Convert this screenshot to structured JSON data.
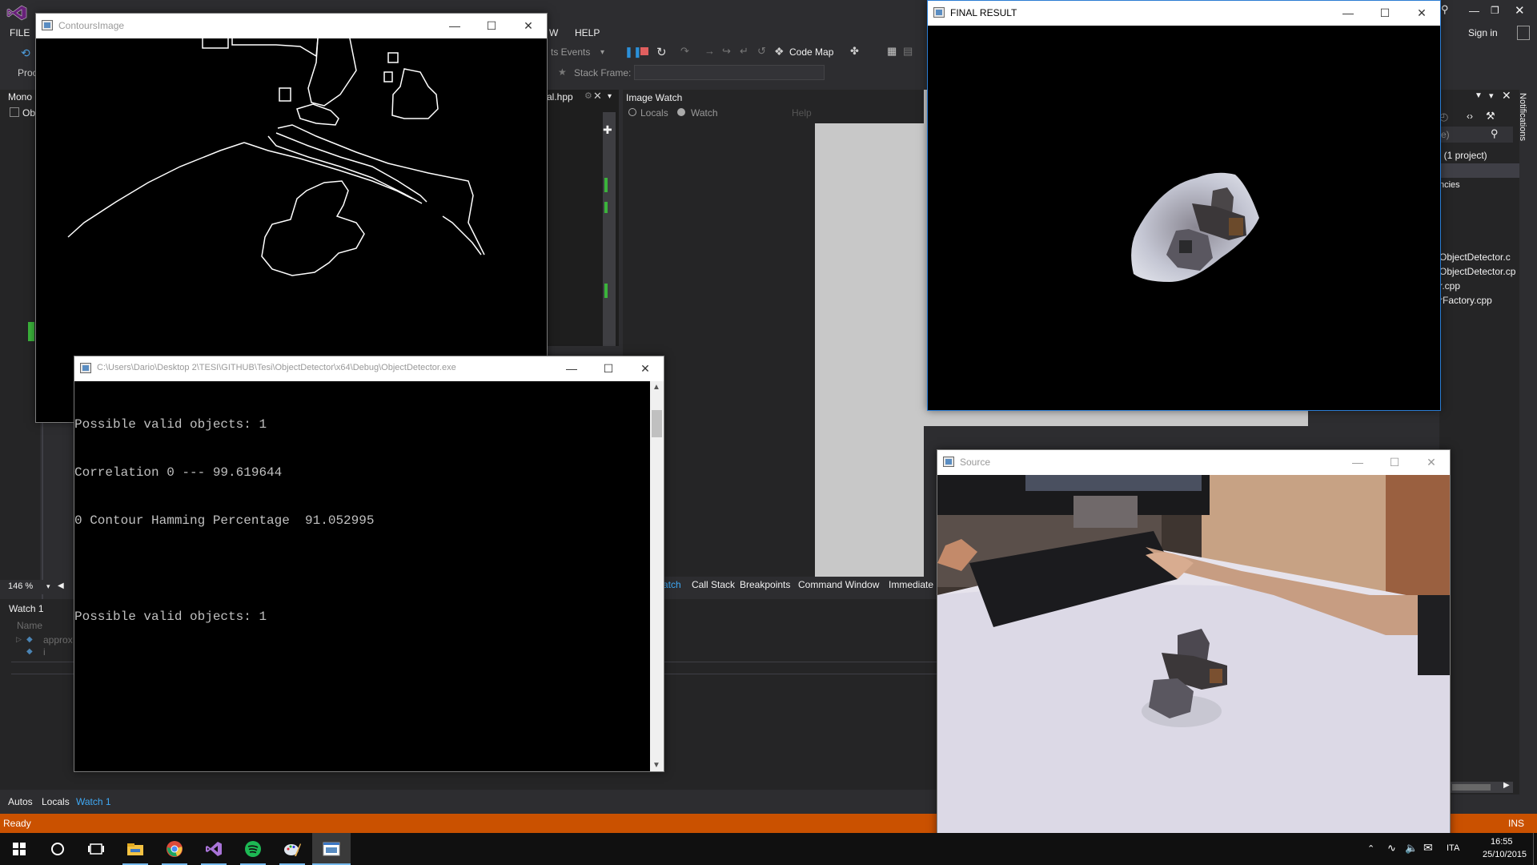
{
  "vs": {
    "menu": {
      "file": "FILE",
      "view_tail": "W",
      "help": "HELP"
    },
    "user": {
      "sign_in": "Sign in"
    },
    "toolbar": {
      "lifecycle": "ts Events",
      "code_map": "Code Map",
      "stack_frame": "Stack Frame:"
    },
    "left_panel": {
      "tab": "Mono",
      "item": "Ob",
      "prefix": "Proc"
    },
    "editor": {
      "file_tab": "al.hpp"
    },
    "image_watch": {
      "title": "Image Watch",
      "radio_locals": "Locals",
      "radio_watch": "Watch",
      "help": "Help"
    },
    "zoom": "146 %",
    "watch": {
      "title": "Watch 1",
      "column_name": "Name",
      "row1": "approx",
      "row2": "i"
    },
    "debug_tabs": [
      "atch",
      "Call Stack",
      "Breakpoints",
      "Command Window",
      "Immediate"
    ],
    "bottom_tabs": [
      "Autos",
      "Locals",
      "Watch 1"
    ],
    "solution": {
      "project": "' (1 project)",
      "deps": "ncies",
      "files": [
        "ObjectDetector.c",
        "ObjectDetector.cp",
        "r.cpp",
        "rFactory.cpp"
      ]
    },
    "notifications": "Notifications",
    "status": {
      "ready": "Ready",
      "ins": "INS"
    }
  },
  "windows": {
    "contours": {
      "title": "ContoursImage"
    },
    "console": {
      "title": "C:\\Users\\Dario\\Desktop 2\\TESI\\GITHUB\\Tesi\\ObjectDetector\\x64\\Debug\\ObjectDetector.exe",
      "lines": [
        "Possible valid objects: 1",
        "Correlation 0 --- 99.619644",
        "0 Contour Hamming Percentage  91.052995",
        "",
        "Possible valid objects: 1"
      ]
    },
    "final": {
      "title": "FINAL RESULT"
    },
    "source": {
      "title": "Source"
    }
  },
  "taskbar": {
    "language": "ITA",
    "time": "16:55",
    "date": "25/10/2015"
  },
  "colors": {
    "vs_bg": "#2d2d30",
    "status_bar": "#ca5100",
    "accent": "#007acc"
  }
}
